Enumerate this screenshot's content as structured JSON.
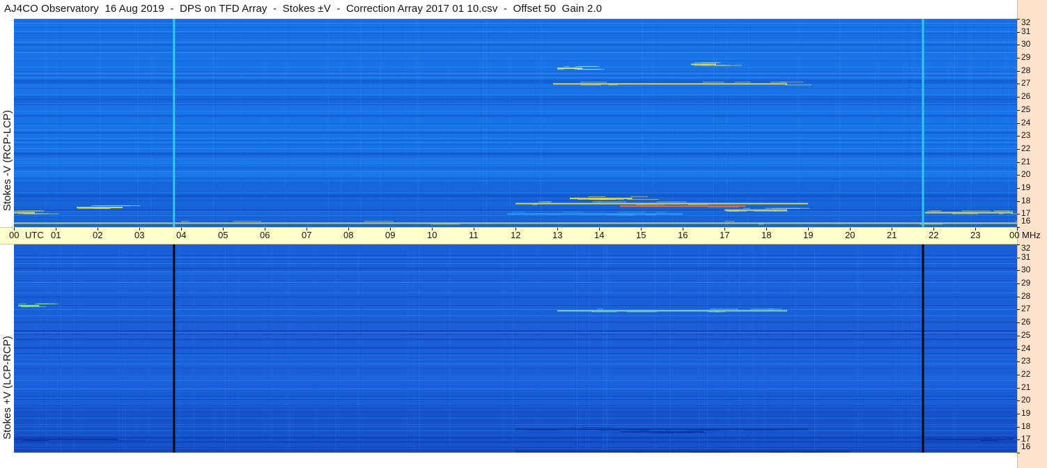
{
  "title": "AJ4CO Observatory  16 Aug 2019  -  DPS on TFD Array  -  Stokes ±V  -  Correction Array 2017 01 10.csv  -  Offset 50  Gain 2.0",
  "chart_data": [
    {
      "type": "heatmap",
      "name": "Stokes -V (RCP-LCP)",
      "ylabel": "Stokes -V (RCP-LCP)",
      "x_unit": "UTC",
      "y_unit": "MHz",
      "xlim": [
        0,
        24
      ],
      "ylim": [
        16,
        32
      ],
      "colors": {
        "base": "#1a73e6",
        "dark": "#0c3fb4",
        "bright": "#36a8ff",
        "hot": "#f2e64a",
        "warm": "#ff6a2a"
      },
      "vertical_lines_utc": [
        3.83,
        21.75
      ],
      "vertical_line_color": "#36d0ff",
      "bursts": [
        {
          "t0": 12.9,
          "t1": 18.5,
          "f": 27.0,
          "kind": "hot"
        },
        {
          "t0": 13.0,
          "t1": 13.6,
          "f": 28.2,
          "kind": "hot"
        },
        {
          "t0": 16.2,
          "t1": 16.8,
          "f": 28.5,
          "kind": "hot"
        },
        {
          "t0": 12.0,
          "t1": 19.0,
          "f": 17.8,
          "kind": "hot"
        },
        {
          "t0": 14.5,
          "t1": 17.5,
          "f": 17.6,
          "kind": "warm"
        },
        {
          "t0": 17.0,
          "t1": 18.5,
          "f": 17.3,
          "kind": "hot"
        },
        {
          "t0": 13.3,
          "t1": 14.8,
          "f": 18.2,
          "kind": "hot"
        },
        {
          "t0": 0.0,
          "t1": 0.5,
          "f": 17.1,
          "kind": "hot"
        },
        {
          "t0": 1.5,
          "t1": 2.6,
          "f": 17.5,
          "kind": "hot"
        },
        {
          "t0": 21.8,
          "t1": 23.9,
          "f": 17.1,
          "kind": "hot"
        },
        {
          "t0": 11.8,
          "t1": 16.0,
          "f": 17.0,
          "kind": "bright"
        },
        {
          "t0": 0.0,
          "t1": 24.0,
          "f": 16.3,
          "kind": "hot"
        }
      ]
    },
    {
      "type": "heatmap",
      "name": "Stokes +V (LCP-RCP)",
      "ylabel": "Stokes +V (LCP-RCP)",
      "x_unit": "UTC",
      "y_unit": "MHz",
      "xlim": [
        0,
        24
      ],
      "ylim": [
        16,
        32
      ],
      "colors": {
        "base": "#1a5fd8",
        "dark": "#0a2fa0",
        "bright": "#36a8ff",
        "hot": "#8ff0a0",
        "warm": "#f2e64a"
      },
      "vertical_lines_utc": [
        3.83,
        21.75
      ],
      "vertical_line_color": "#000000",
      "bursts": [
        {
          "t0": 13.0,
          "t1": 18.5,
          "f": 26.9,
          "kind": "hot"
        },
        {
          "t0": 0.1,
          "t1": 0.6,
          "f": 27.3,
          "kind": "hot"
        },
        {
          "t0": 12.0,
          "t1": 19.0,
          "f": 17.8,
          "kind": "dark"
        },
        {
          "t0": 14.5,
          "t1": 16.5,
          "f": 17.6,
          "kind": "dark"
        },
        {
          "t0": 0.0,
          "t1": 2.5,
          "f": 17.0,
          "kind": "dark"
        },
        {
          "t0": 21.8,
          "t1": 23.9,
          "f": 17.0,
          "kind": "dark"
        },
        {
          "t0": 12.0,
          "t1": 20.0,
          "f": 16.1,
          "kind": "dark"
        }
      ]
    }
  ],
  "time_axis": {
    "ticks": [
      "00",
      "01",
      "02",
      "03",
      "04",
      "05",
      "06",
      "07",
      "08",
      "09",
      "10",
      "11",
      "12",
      "13",
      "14",
      "15",
      "16",
      "17",
      "18",
      "19",
      "20",
      "21",
      "22",
      "23",
      "00"
    ],
    "utc_label": "UTC",
    "unit_label": "MHz"
  },
  "freq_ticks": [
    "32",
    "31",
    "30",
    "29",
    "28",
    "27",
    "26",
    "25",
    "24",
    "23",
    "22",
    "21",
    "20",
    "19",
    "18",
    "17",
    "16"
  ]
}
